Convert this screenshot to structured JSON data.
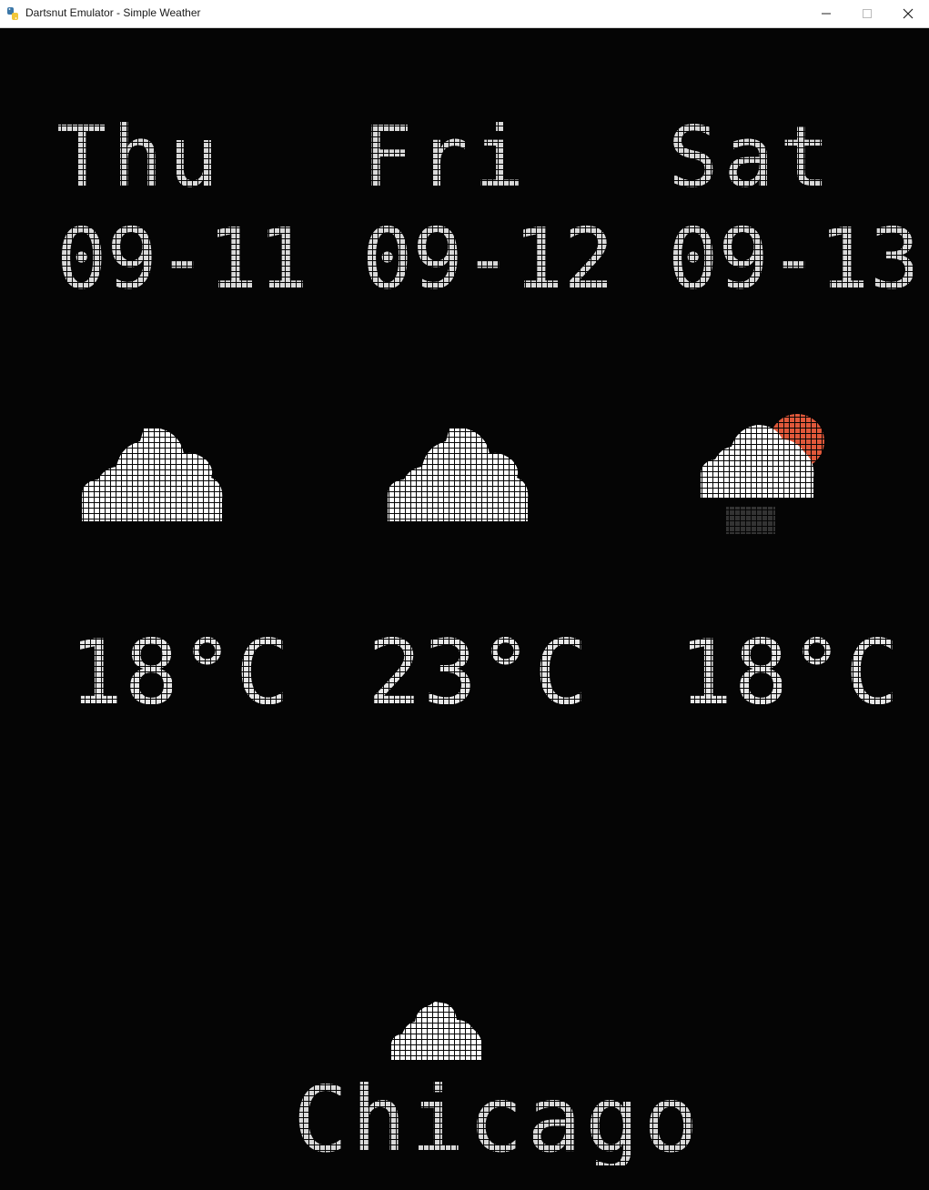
{
  "window": {
    "title": "Dartsnut Emulator - Simple Weather",
    "controls": {
      "minimize": "minimize-icon",
      "maximize": "maximize-icon",
      "close": "close-icon"
    }
  },
  "forecast": [
    {
      "day": "Thu",
      "date": "09-11",
      "icon": "cloud-icon",
      "temp": "18°C"
    },
    {
      "day": "Fri",
      "date": "09-12",
      "icon": "cloud-icon",
      "temp": "23°C"
    },
    {
      "day": "Sat",
      "date": "09-13",
      "icon": "sun-cloud-rain-icon",
      "temp": "18°C"
    }
  ],
  "current": {
    "icon": "cloud-icon",
    "city": "Chicago"
  },
  "colors": {
    "background": "#050505",
    "text": "#d9d9d9",
    "cloud": "#ffffff",
    "sun": "#e0583a"
  }
}
